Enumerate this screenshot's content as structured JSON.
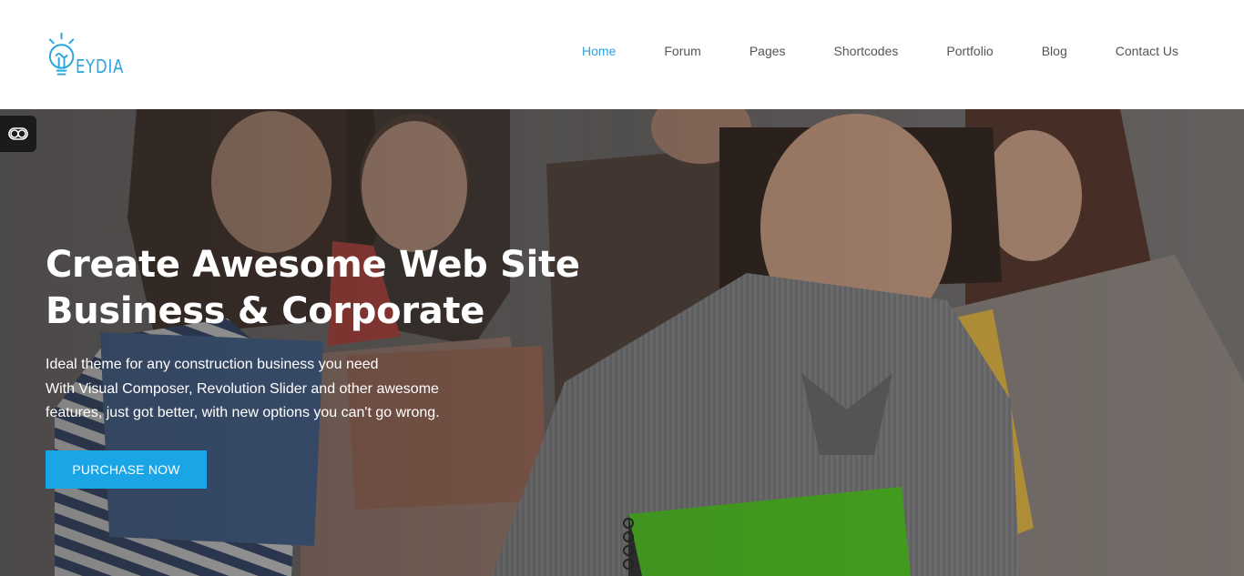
{
  "brand": {
    "logo_text": "EYDIA",
    "accent": "#29a6df"
  },
  "nav": {
    "items": [
      {
        "label": "Home",
        "active": true
      },
      {
        "label": "Forum",
        "active": false
      },
      {
        "label": "Pages",
        "active": false
      },
      {
        "label": "Shortcodes",
        "active": false
      },
      {
        "label": "Portfolio",
        "active": false
      },
      {
        "label": "Blog",
        "active": false
      },
      {
        "label": "Contact Us",
        "active": false
      }
    ]
  },
  "hero": {
    "title_line1": "Create Awesome Web Site",
    "title_line2": "Business & Corporate",
    "desc_line1": "Ideal theme for any construction business you need",
    "desc_line2": "With Visual Composer, Revolution Slider and other awesome",
    "desc_line3": "features, just got better, with new options you can't go wrong.",
    "cta_label": "PURCHASE NOW",
    "cta_color": "#1aa5e6"
  },
  "side_toggle": {
    "icon": "toggle-icon"
  }
}
